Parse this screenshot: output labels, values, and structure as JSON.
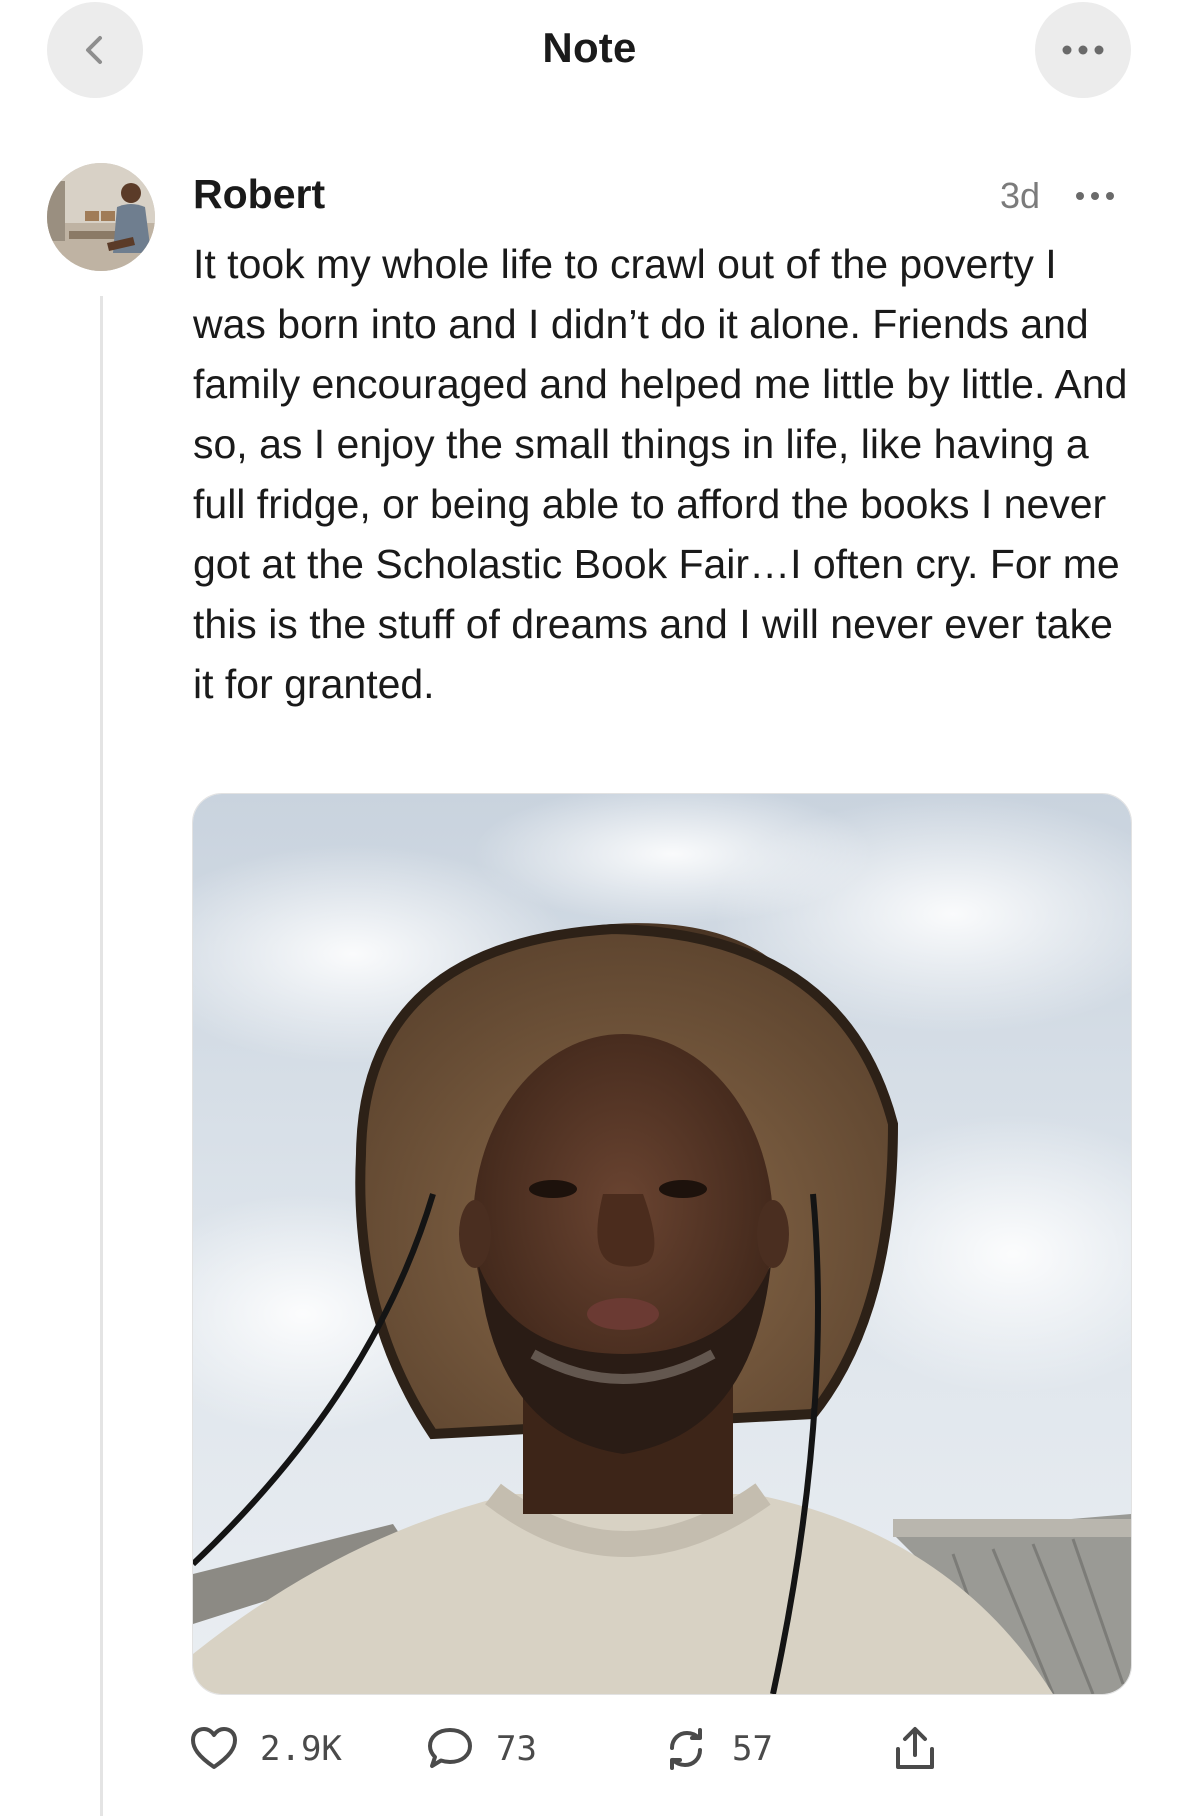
{
  "header": {
    "title": "Note",
    "back_icon": "chevron-left-icon",
    "more_icon": "ellipsis-icon"
  },
  "note": {
    "author": "Robert",
    "time": "3d",
    "text": "It took my whole life to crawl out of the poverty  I was born into and I didn’t do it alone. Friends and family encouraged and helped me little by little. And so, as I enjoy the small things in life, like having a full fridge, or being able to afford the books I never got at the Scholastic Book Fair…I often cry. For me this is the stuff of dreams and I will never ever take it for granted.",
    "image_subject": "selfie of a smiling man in a wide-brim hat and cream sweater under a cloudy sky"
  },
  "actions": {
    "likes": "2.9K",
    "comments": "73",
    "restacks": "57",
    "like_icon": "heart-icon",
    "comment_icon": "comment-icon",
    "restack_icon": "restack-icon",
    "share_icon": "share-icon"
  },
  "colors": {
    "text": "#1a1a1a",
    "muted": "#7b7b7b",
    "nav_button_bg": "#ececec",
    "icon": "#4a4a4a"
  }
}
